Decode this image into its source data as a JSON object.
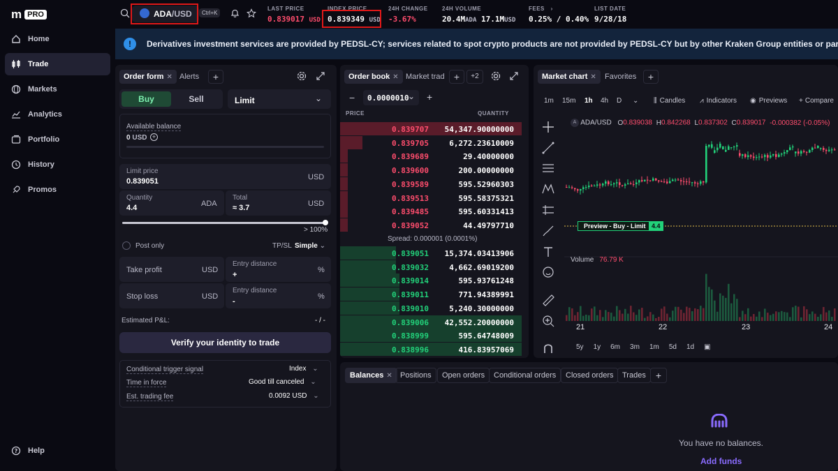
{
  "brand": {
    "mark": "m",
    "badge": "PRO"
  },
  "sidebar": {
    "items": [
      {
        "label": "Home",
        "icon": "home-icon"
      },
      {
        "label": "Trade",
        "icon": "candles-icon"
      },
      {
        "label": "Markets",
        "icon": "globe-icon"
      },
      {
        "label": "Analytics",
        "icon": "chart-line-icon"
      },
      {
        "label": "Portfolio",
        "icon": "wallet-icon"
      },
      {
        "label": "History",
        "icon": "history-icon"
      },
      {
        "label": "Promos",
        "icon": "rocket-icon"
      }
    ],
    "help": "Help"
  },
  "topbar": {
    "pair_base": "ADA",
    "pair_quote": "/USD",
    "shortcut": "Ctrl+K",
    "stats": [
      {
        "label": "LAST PRICE",
        "value": "0.839017",
        "unit": "USD"
      },
      {
        "label": "INDEX PRICE",
        "value": "0.839349",
        "unit": "USD"
      },
      {
        "label": "24H CHANGE",
        "value": "-3.67%"
      },
      {
        "label": "24H VOLUME",
        "value": "20.4M",
        "unit": "ADA",
        "value2": "17.1M",
        "unit2": "USD"
      },
      {
        "label": "FEES",
        "value": "0.25% / 0.40%"
      },
      {
        "label": "LIST DATE",
        "value": "9/28/18"
      }
    ]
  },
  "banner": {
    "text": "Derivatives investment services are provided by PEDSL-CY; services related to spot crypto products are not provided by PEDSL-CY but by other Kraken Group entities or partners."
  },
  "order_form": {
    "tabs": [
      "Order form",
      "Alerts"
    ],
    "buy": "Buy",
    "sell": "Sell",
    "order_type": "Limit",
    "available_label": "Available balance",
    "available_value": "0",
    "available_unit": "USD",
    "limit_label": "Limit price",
    "limit_value": "0.839051",
    "limit_unit": "USD",
    "qty_label": "Quantity",
    "qty_value": "4.4",
    "qty_unit": "ADA",
    "total_label": "Total",
    "total_value": "≈ 3.7",
    "total_unit": "USD",
    "slider_pct": "> 100%",
    "slider_fraction": 1.0,
    "post_only": "Post only",
    "tpsl": "TP/SL",
    "tpsl_mode": "Simple",
    "take_profit": "Take profit",
    "stop_loss": "Stop loss",
    "unit_usd": "USD",
    "entry_distance": "Entry distance",
    "plus": "+",
    "minus": "-",
    "pct": "%",
    "pnl_label": "Estimated P&L:",
    "pnl_value": "- / -",
    "verify": "Verify your identity to trade",
    "trigger_label": "Conditional trigger signal",
    "trigger_value": "Index",
    "tif_label": "Time in force",
    "tif_value": "Good till canceled",
    "fee_label": "Est. trading fee",
    "fee_value": "0.0092 USD"
  },
  "order_book": {
    "tabs": [
      "Order book",
      "Market trad"
    ],
    "more": "+2",
    "tick": "0.0000010",
    "price_header": "PRICE",
    "qty_header": "QUANTITY",
    "asks": [
      {
        "price": "0.839707",
        "qty": "54,347.90000000",
        "depth": 0.98
      },
      {
        "price": "0.839705",
        "qty": "6,272.23610009",
        "depth": 0.12
      },
      {
        "price": "0.839689",
        "qty": "29.40000000",
        "depth": 0.04
      },
      {
        "price": "0.839600",
        "qty": "200.00000000",
        "depth": 0.04
      },
      {
        "price": "0.839589",
        "qty": "595.52960303",
        "depth": 0.04
      },
      {
        "price": "0.839513",
        "qty": "595.58375321",
        "depth": 0.04
      },
      {
        "price": "0.839485",
        "qty": "595.60331413",
        "depth": 0.04
      },
      {
        "price": "0.839052",
        "qty": "44.49797710",
        "depth": 0.04
      }
    ],
    "spread": "Spread: 0.000001 (0.0001%)",
    "bids": [
      {
        "price": "0.839051",
        "qty": "15,374.03413906",
        "depth": 0.3
      },
      {
        "price": "0.839032",
        "qty": "4,662.69019200",
        "depth": 0.3
      },
      {
        "price": "0.839014",
        "qty": "595.93761248",
        "depth": 0.32
      },
      {
        "price": "0.839011",
        "qty": "771.94389991",
        "depth": 0.32
      },
      {
        "price": "0.839010",
        "qty": "5,240.30000000",
        "depth": 0.32
      },
      {
        "price": "0.839006",
        "qty": "42,552.20000000",
        "depth": 0.98
      },
      {
        "price": "0.838999",
        "qty": "595.64748009",
        "depth": 0.98
      },
      {
        "price": "0.838996",
        "qty": "416.83957069",
        "depth": 0.98
      }
    ]
  },
  "chart": {
    "tabs": [
      "Market chart",
      "Favorites"
    ],
    "intervals": [
      "1m",
      "15m",
      "1h",
      "4h",
      "D"
    ],
    "active_interval": "1h",
    "candles": "Candles",
    "indicators": "Indicators",
    "previews": "Previews",
    "compare": "Compare",
    "symbol": "ADA/USD",
    "ohlc": {
      "o": "0.839038",
      "h": "0.842268",
      "l": "0.837302",
      "c": "0.839017",
      "chg": "-0.000382 (-0.05%)"
    },
    "preview_label": "Preview - Buy - Limit",
    "preview_qty": "4.4",
    "volume_label": "Volume",
    "volume_value": "76.79 K",
    "x_labels": [
      "21",
      "22",
      "23",
      "24"
    ],
    "ranges": [
      "5y",
      "1y",
      "6m",
      "3m",
      "1m",
      "5d",
      "1d"
    ]
  },
  "bottom": {
    "tabs": [
      "Balances",
      "Positions",
      "Open orders",
      "Conditional orders",
      "Closed orders",
      "Trades"
    ],
    "empty": "You have no balances.",
    "add_funds": "Add funds"
  },
  "colors": {
    "ask": "#ff4d6d",
    "bid": "#22d17a",
    "accent": "#8a6cff",
    "highlight": "#e01818"
  }
}
